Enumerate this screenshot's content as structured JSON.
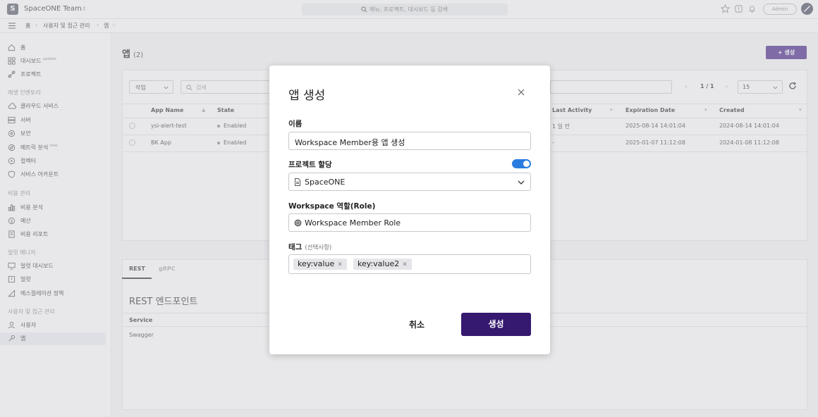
{
  "topbar": {
    "logo_letter": "S",
    "workspace_name": "SpaceONE Team",
    "search_placeholder": "메뉴, 프로젝트, 대시보드 등 검색",
    "admin_label": "Admin"
  },
  "breadcrumb": {
    "items": [
      "홈",
      "사용자 및 접근 관리",
      "앱"
    ]
  },
  "sidebar": {
    "home": "홈",
    "dashboard": "대시보드",
    "dashboard_badge": "update",
    "project": "프로젝트",
    "section_asset": "에셋 인벤토리",
    "cloud_service": "클라우드 서비스",
    "server": "서버",
    "security": "보안",
    "metric_explorer": "메트릭 분석",
    "metric_badge": "new",
    "collector": "컬렉터",
    "service_account": "서비스 어카운트",
    "section_cost": "비용 관리",
    "cost_analysis": "비용 분석",
    "budget": "예산",
    "cost_report": "비용 리포트",
    "section_alert": "얼럿 매니저",
    "alert_dashboard": "얼럿 대시보드",
    "alert": "얼럿",
    "escalation_policy": "에스컬레이션 정책",
    "section_iam": "사용자 및 접근 관리",
    "user": "사용자",
    "app": "앱"
  },
  "page": {
    "title": "앱",
    "count": "(2)",
    "create_button": "+ 생성"
  },
  "toolbar": {
    "action_label": "작업",
    "search_placeholder": "검색",
    "page_current": "1 / 1",
    "page_size": "15"
  },
  "table": {
    "headers": {
      "name": "App Name",
      "state": "State",
      "last_activity": "Last Activity",
      "expiration": "Expiration Date",
      "created": "Created"
    },
    "rows": [
      {
        "name": "ysi-alert-test",
        "state": "Enabled",
        "last_activity": "1 일 전",
        "expiration": "2025-08-14 14:01:04",
        "created": "2024-08-14 14:01:04"
      },
      {
        "name": "BK App",
        "state": "Enabled",
        "last_activity": "-",
        "expiration": "2025-01-07 11:12:08",
        "created": "2024-01-08 11:12:08"
      }
    ]
  },
  "detail": {
    "tab_rest": "REST",
    "tab_grpc": "gRPC",
    "rest_title": "REST 엔드포인트",
    "service_header": "Service",
    "service_value": "Swagger"
  },
  "modal": {
    "title": "앱 생성",
    "name_label": "이름",
    "name_value": "Workspace Member용 앱 생성",
    "project_label": "프로젝트 할당",
    "project_value": "SpaceONE",
    "project_toggle_on": true,
    "role_label": "Workspace 역할(Role)",
    "role_value": "Workspace Member Role",
    "tags_label": "태그",
    "tags_optional": "(선택사항)",
    "tags": [
      "key:value",
      "key:value2"
    ],
    "cancel_label": "취소",
    "submit_label": "생성"
  },
  "colors": {
    "brand_primary": "#4b2a8a",
    "submit_button": "#35186f",
    "toggle_on": "#2a7ce0"
  }
}
